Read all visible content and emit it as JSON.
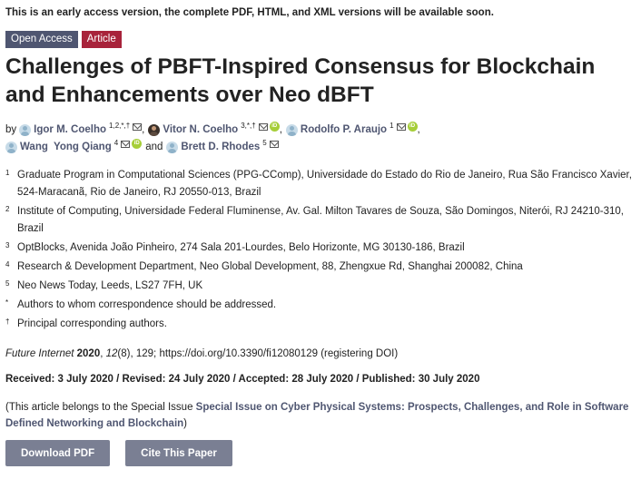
{
  "notice": "This is an early access version, the complete PDF, HTML, and XML versions will be available soon.",
  "badges": {
    "open_access": "Open Access",
    "article": "Article"
  },
  "title": "Challenges of PBFT-Inspired Consensus for Blockchain and Enhancements over Neo dBFT",
  "authors_block": {
    "by": "by",
    "authors": [
      {
        "name": "Igor M. Coelho",
        "sup": "1,2,*,†",
        "orcid": false
      },
      {
        "name": "Vitor N. Coelho",
        "sup": "3,*,†",
        "orcid": true
      },
      {
        "name": "Rodolfo P. Araujo",
        "sup": "1",
        "orcid": true
      },
      {
        "name": "Wang  Yong Qiang",
        "sup": "4",
        "orcid": true
      },
      {
        "name": "Brett D. Rhodes",
        "sup": "5",
        "orcid": false
      }
    ],
    "and": "and",
    "comma": ","
  },
  "affiliations": [
    {
      "num": "1",
      "text": "Graduate Program in Computational Sciences (PPG-CComp), Universidade do Estado do Rio de Janeiro, Rua São Francisco Xavier, 524-Maracanã, Rio de Janeiro, RJ 20550-013, Brazil"
    },
    {
      "num": "2",
      "text": "Institute of Computing, Universidade Federal Fluminense, Av. Gal. Milton Tavares de Souza, São Domingos, Niterói, RJ 24210-310, Brazil"
    },
    {
      "num": "3",
      "text": "OptBlocks, Avenida João Pinheiro, 274 Sala 201-Lourdes, Belo Horizonte, MG 30130-186, Brazil"
    },
    {
      "num": "4",
      "text": "Research & Development Department, Neo Global Development, 88, Zhengxue Rd, Shanghai 200082, China"
    },
    {
      "num": "5",
      "text": "Neo News Today, Leeds, LS27 7FH, UK"
    },
    {
      "num": "*",
      "text": "Authors to whom correspondence should be addressed."
    },
    {
      "num": "†",
      "text": "Principal corresponding authors."
    }
  ],
  "citation": {
    "journal": "Future Internet",
    "year": "2020",
    "volume": "12",
    "issue_pages": "(8), 129; https://doi.org/10.3390/fi12080129 (registering DOI)"
  },
  "dates": "Received: 3 July 2020 / Revised: 24 July 2020 / Accepted: 28 July 2020 / Published: 30 July 2020",
  "special_issue": {
    "prefix": "(This article belongs to the Special Issue ",
    "link": "Special Issue on Cyber Physical Systems: Prospects, Challenges, and Role in Software Defined Networking and Blockchain",
    "suffix": ")"
  },
  "buttons": {
    "download_pdf": "Download PDF",
    "cite": "Cite This Paper"
  },
  "colors": {
    "badge_open_access": "#4f5671",
    "badge_article": "#a8233b",
    "link": "#4f5671",
    "button": "#7a7f93",
    "orcid": "#a6ce39"
  },
  "icons": {
    "author": "author-avatar-icon",
    "email": "envelope-icon",
    "orcid": "orcid-icon"
  }
}
